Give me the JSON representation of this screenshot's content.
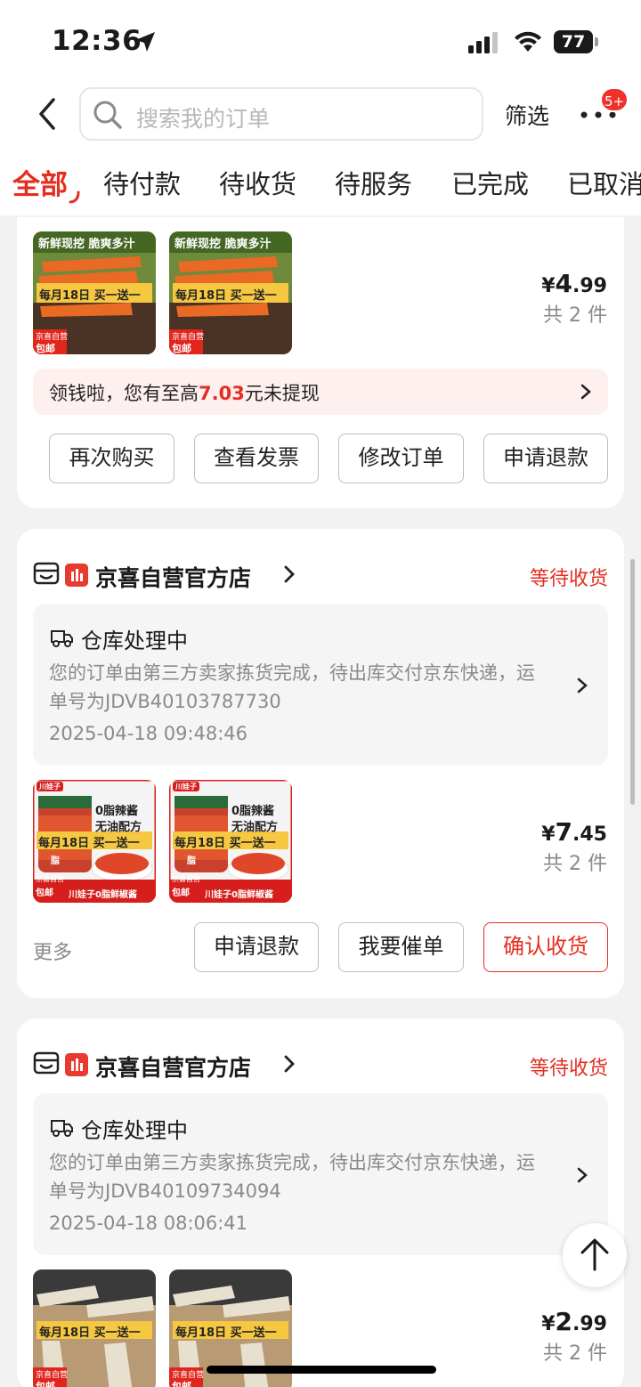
{
  "status_bar": {
    "time": "12:36",
    "battery": "77"
  },
  "header": {
    "search_placeholder": "搜索我的订单",
    "filter_label": "筛选",
    "message_badge": "5+"
  },
  "tabs": [
    {
      "label": "全部",
      "active": true
    },
    {
      "label": "待付款"
    },
    {
      "label": "待收货"
    },
    {
      "label": "待服务"
    },
    {
      "label": "已完成"
    },
    {
      "label": "已取消"
    }
  ],
  "orders": [
    {
      "product": {
        "banner_top": "新鲜现挖  脆爽多汁",
        "promo": "每月18日 买一送一",
        "tag1": "京喜自营",
        "tag2": "包邮"
      },
      "price_prefix": "¥",
      "price_int": "4",
      "price_dec": ".99",
      "count": "共 2 件",
      "promo_before": "领钱啦，您有至高",
      "promo_amount": "7.03",
      "promo_after": "元未提现",
      "buttons": [
        "再次购买",
        "查看发票",
        "修改订单",
        "申请退款"
      ]
    },
    {
      "shop": "京喜自营官方店",
      "status": "等待收货",
      "logistics_title": "仓库处理中",
      "logistics_desc": "您的订单由第三方卖家拣货完成，待出库交付京东快递，运单号为JDVB40103787730",
      "logistics_time": "2025-04-18 09:48:46",
      "product": {
        "brand": "川娃子",
        "line1": "0脂辣酱",
        "line2": "无油配方",
        "promo": "每月18日 买一送一",
        "tag1": "京喜自营",
        "tag2": "包邮",
        "bottom": "川娃子0脂鲜椒酱",
        "jar": "脂"
      },
      "price_prefix": "¥",
      "price_int": "7",
      "price_dec": ".45",
      "count": "共 2 件",
      "more_label": "更多",
      "buttons": [
        "申请退款",
        "我要催单",
        "确认收货"
      ]
    },
    {
      "shop": "京喜自营官方店",
      "status": "等待收货",
      "logistics_title": "仓库处理中",
      "logistics_desc": "您的订单由第三方卖家拣货完成，待出库交付京东快递，运单号为JDVB40109734094",
      "logistics_time": "2025-04-18 08:06:41",
      "product": {
        "promo": "每月18日 买一送一",
        "tag1": "京喜自营",
        "tag2": "包邮"
      },
      "price_prefix": "¥",
      "price_int": "2",
      "price_dec": ".99",
      "count": "共 2 件"
    }
  ],
  "colors": {
    "accent": "#e52e21",
    "background": "#f2f2f2"
  }
}
